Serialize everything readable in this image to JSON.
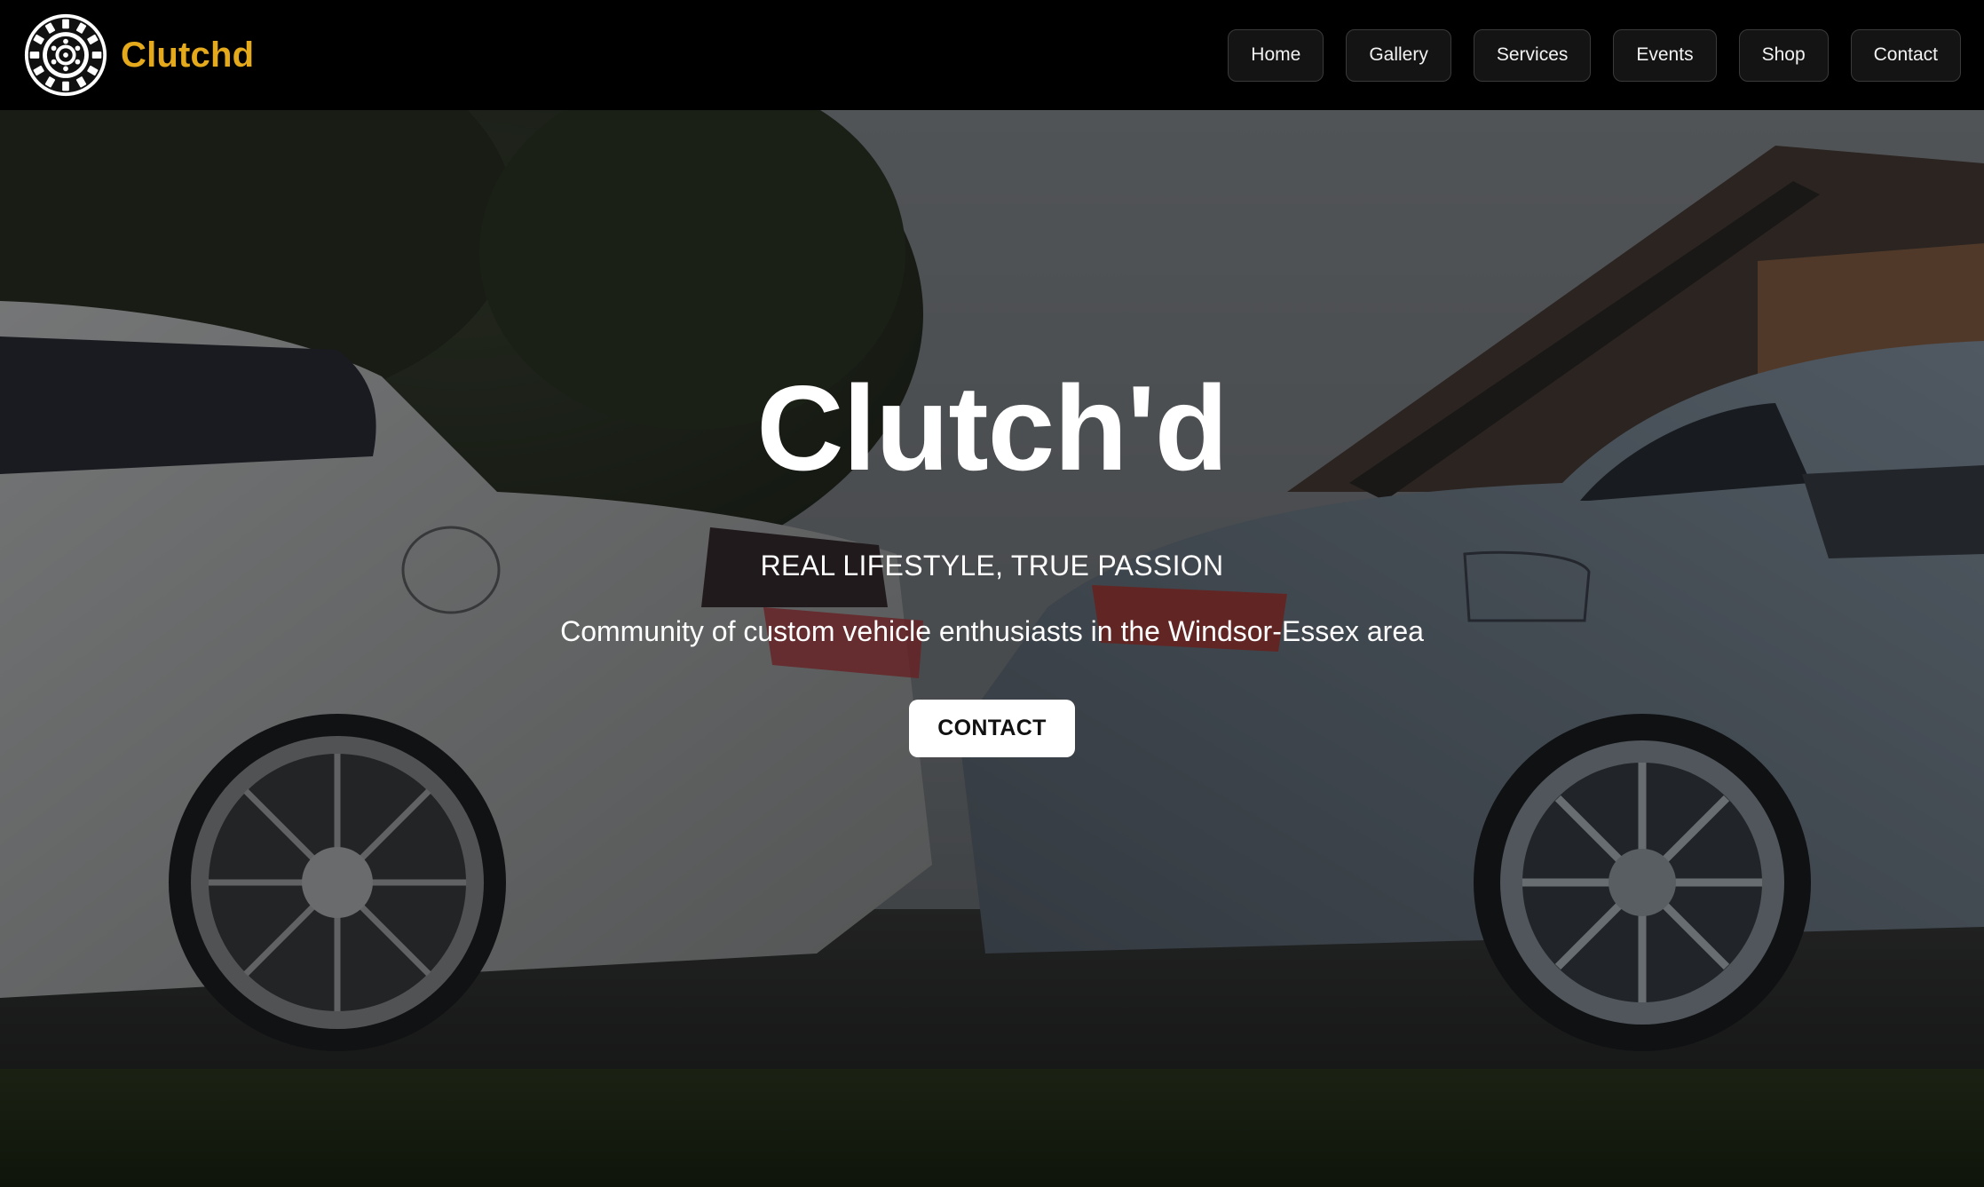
{
  "header": {
    "logo_icon": "clutch-disc-logo-icon",
    "brand_name": "Clutchd",
    "brand_color": "#e5a91c",
    "nav": [
      {
        "label": "Home"
      },
      {
        "label": "Gallery"
      },
      {
        "label": "Services"
      },
      {
        "label": "Events"
      },
      {
        "label": "Shop"
      },
      {
        "label": "Contact"
      }
    ]
  },
  "hero": {
    "background": "lowered-cars-photo",
    "title": "Clutch'd",
    "tagline": "REAL LIFESTYLE, TRUE PASSION",
    "description": "Community of custom vehicle enthusiasts in the Windsor-Essex area",
    "cta_label": "CONTACT"
  }
}
